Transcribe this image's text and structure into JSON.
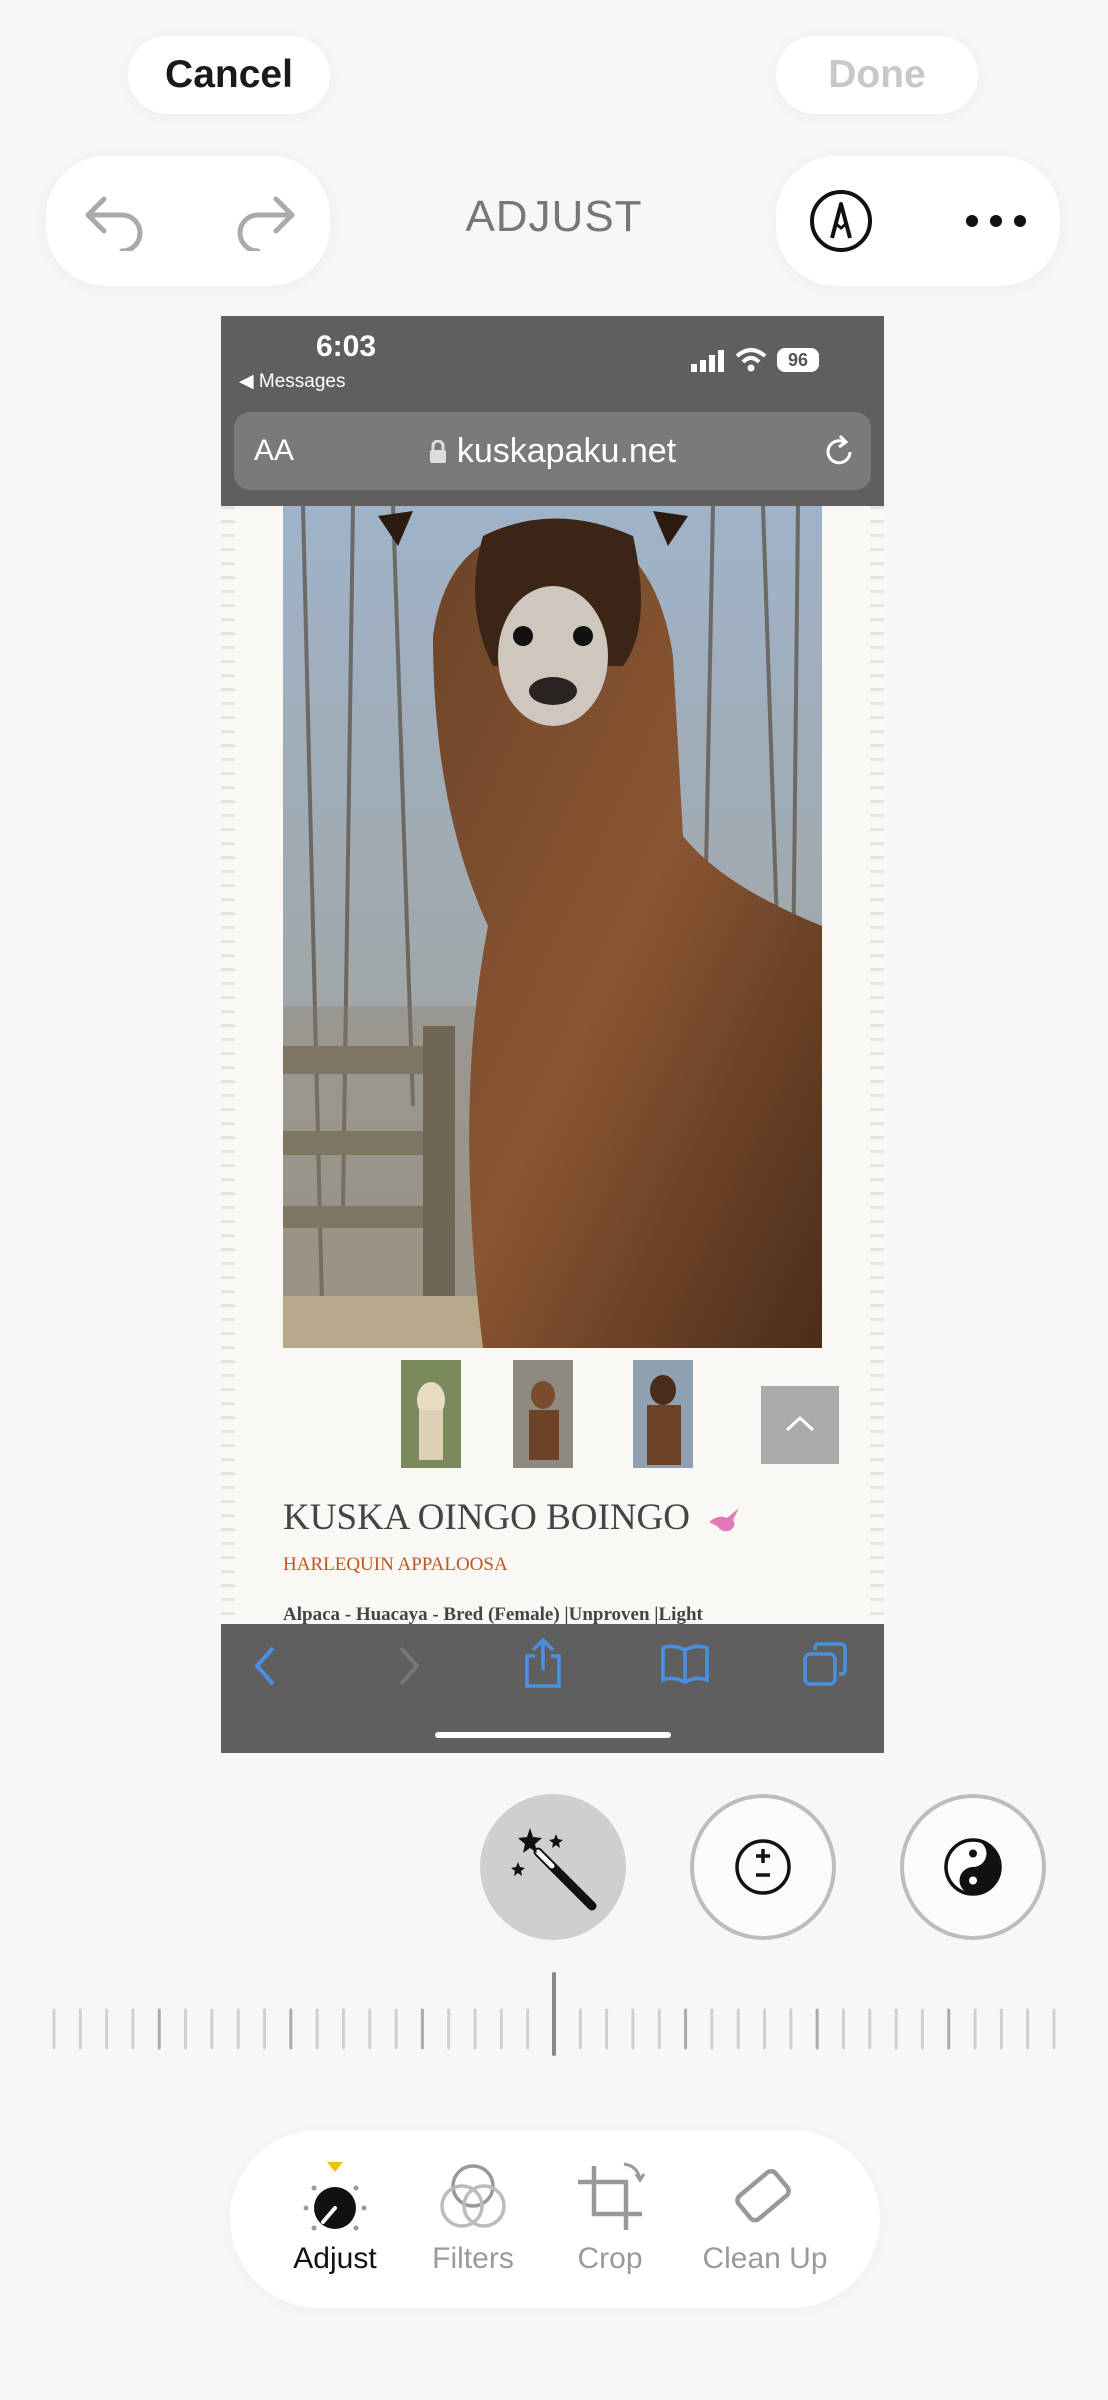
{
  "header": {
    "cancel_label": "Cancel",
    "done_label": "Done",
    "mode_title": "ADJUST"
  },
  "screenshot": {
    "status_bar": {
      "time": "6:03",
      "back_app": "◀ Messages",
      "battery": "96"
    },
    "url": "kuskapaku.net",
    "text_size_label": "AA",
    "alpaca_name": "KUSKA OINGO BOINGO",
    "alpaca_subtitle": "HARLEQUIN APPALOOSA",
    "alpaca_desc": "Alpaca - Huacaya - Bred (Female) |Unproven |Light"
  },
  "adjust_tools": [
    "magic-wand-icon",
    "exposure-icon",
    "brilliance-icon"
  ],
  "tabs": [
    {
      "label": "Adjust",
      "icon": "adjust-dial-icon",
      "active": true
    },
    {
      "label": "Filters",
      "icon": "filters-icon",
      "active": false
    },
    {
      "label": "Crop",
      "icon": "crop-icon",
      "active": false
    },
    {
      "label": "Clean Up",
      "icon": "eraser-icon",
      "active": false
    }
  ],
  "colors": {
    "accent_indicator": "#f2c200",
    "safari_blue": "#4a90e2"
  }
}
